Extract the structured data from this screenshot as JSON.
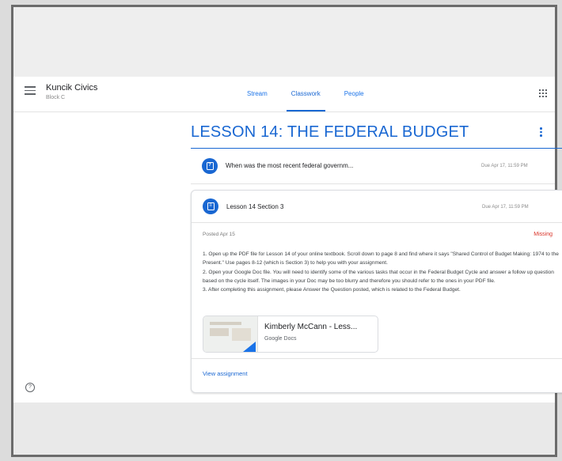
{
  "header": {
    "class_name": "Kuncik Civics",
    "class_section": "Block C",
    "tabs": [
      {
        "label": "Stream"
      },
      {
        "label": "Classwork"
      },
      {
        "label": "People"
      }
    ]
  },
  "topic": {
    "title": "LESSON 14: THE FEDERAL BUDGET"
  },
  "question_item": {
    "title": "When was the most recent federal governm...",
    "due": "Due Apr 17, 11:59 PM"
  },
  "assignment": {
    "title": "Lesson 14 Section 3",
    "due": "Due Apr 17, 11:59 PM",
    "posted": "Posted Apr 15",
    "status": "Missing",
    "instructions": [
      "1. Open up the PDF file for Lesson 14 of your online textbook. Scroll down to page 8 and find where it says \"Shared Control of Budget Making: 1974 to the Present.\" Use pages 8-12 (which is Section 3) to help you with your assignment.",
      "2. Open your Google Doc file. You will need to identify some of the various tasks that occur in the Federal Budget Cycle and answer a follow up question based on the cycle itself. The images in your Doc may be too blurry and therefore you should refer to the ones in your PDF file.",
      "3. After completing this assignment, please Answer the Question posted, which is related to the Federal Budget."
    ],
    "attachment": {
      "title": "Kimberly McCann - Less...",
      "type": "Google Docs"
    },
    "view_link": "View assignment"
  },
  "help_glyph": "?",
  "colors": {
    "accent": "#1967d2",
    "missing": "#d93025"
  }
}
